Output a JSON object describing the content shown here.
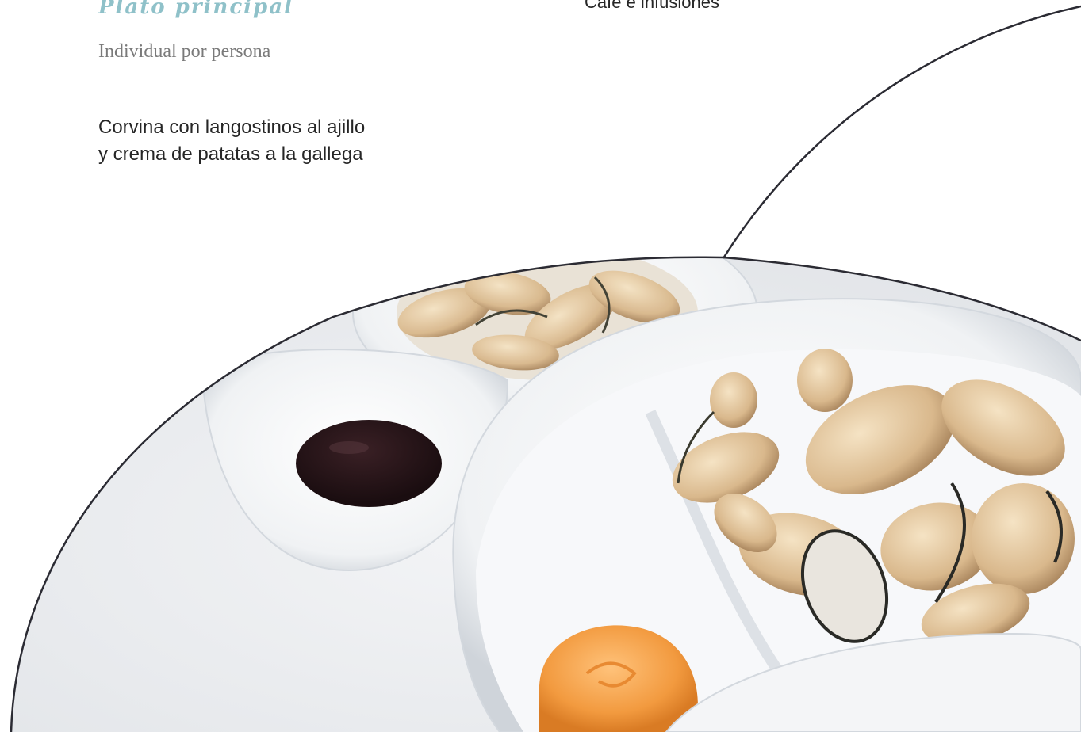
{
  "menu": {
    "section_title": "Plato principal",
    "section_subtitle": "Individual por persona",
    "dish_lines": [
      "Corvina con langostinos al ajillo",
      "y crema de patatas a la gallega"
    ],
    "coffee_text": "Café e infusiones"
  },
  "photo": {
    "subject": "fried-eggplant-chips-with-sauces-photo"
  },
  "colors": {
    "title_accent": "#8fc1c9",
    "subtitle_gray": "#7a7a7a",
    "body_text": "#262626",
    "frame_line": "#2b2b33"
  }
}
